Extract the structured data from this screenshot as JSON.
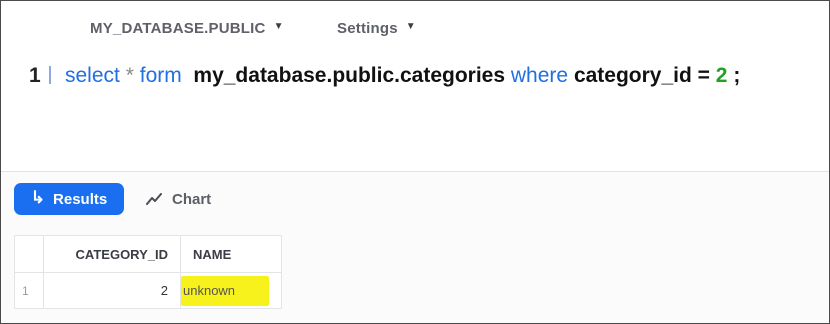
{
  "toolbar": {
    "database_label": "MY_DATABASE.PUBLIC",
    "settings_label": "Settings"
  },
  "editor": {
    "line_number": "1",
    "tokens": {
      "select": "select",
      "star": "*",
      "form": "form",
      "table": "my_database.public.categories",
      "where": "where",
      "column": "category_id",
      "equals": "=",
      "value": "2",
      "semicolon": ";"
    }
  },
  "results": {
    "results_tab_label": "Results",
    "chart_tab_label": "Chart",
    "columns": [
      "CATEGORY_ID",
      "NAME"
    ],
    "rows": [
      {
        "row_number": "1",
        "category_id": "2",
        "name": "unknown"
      }
    ]
  },
  "colors": {
    "accent": "#1a6ff0",
    "keyword": "#1f6fe5",
    "number": "#21a121",
    "highlight": "#f7f21c"
  }
}
